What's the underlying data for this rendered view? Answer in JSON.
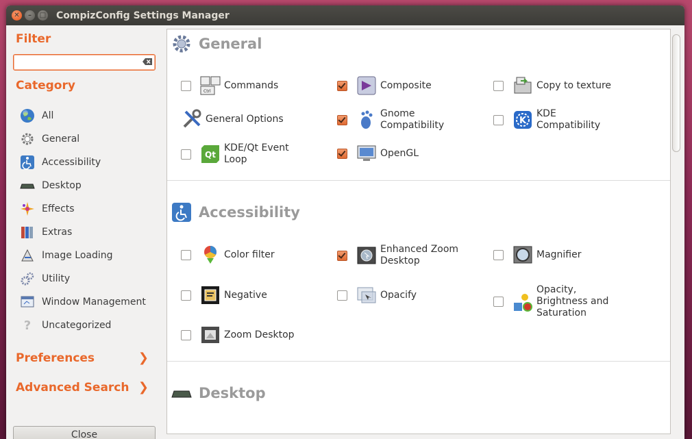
{
  "window": {
    "title": "CompizConfig Settings Manager"
  },
  "sidebar": {
    "filter_heading": "Filter",
    "filter_value": "",
    "category_heading": "Category",
    "categories": [
      {
        "label": "All",
        "icon": "globe-icon"
      },
      {
        "label": "General",
        "icon": "gear-icon"
      },
      {
        "label": "Accessibility",
        "icon": "wheelchair-icon"
      },
      {
        "label": "Desktop",
        "icon": "desktop-icon"
      },
      {
        "label": "Effects",
        "icon": "sparkle-icon"
      },
      {
        "label": "Extras",
        "icon": "books-icon"
      },
      {
        "label": "Image Loading",
        "icon": "image-loading-icon"
      },
      {
        "label": "Utility",
        "icon": "utility-gears-icon"
      },
      {
        "label": "Window Management",
        "icon": "window-icon"
      },
      {
        "label": "Uncategorized",
        "icon": "question-icon"
      }
    ],
    "preferences": "Preferences",
    "advanced_search": "Advanced Search",
    "close_label": "Close"
  },
  "sections": {
    "general": {
      "title": "General",
      "plugins": [
        {
          "label": "Commands",
          "checked": false
        },
        {
          "label": "Composite",
          "checked": true
        },
        {
          "label": "Copy to texture",
          "checked": false
        },
        {
          "label": "General Options",
          "checked": null
        },
        {
          "label_line1": "Gnome",
          "label_line2": "Compatibility",
          "checked": true
        },
        {
          "label_line1": "KDE",
          "label_line2": "Compatibility",
          "checked": false
        },
        {
          "label_line1": "KDE/Qt Event",
          "label_line2": "Loop",
          "checked": false
        },
        {
          "label": "OpenGL",
          "checked": true
        }
      ]
    },
    "accessibility": {
      "title": "Accessibility",
      "plugins": [
        {
          "label": "Color filter",
          "checked": false
        },
        {
          "label_line1": "Enhanced Zoom",
          "label_line2": "Desktop",
          "checked": true
        },
        {
          "label": "Magnifier",
          "checked": false
        },
        {
          "label": "Negative",
          "checked": false
        },
        {
          "label": "Opacify",
          "checked": false
        },
        {
          "label_line1": "Opacity,",
          "label_line2": "Brightness and",
          "label_line3": "Saturation",
          "checked": false
        },
        {
          "label": "Zoom Desktop",
          "checked": false
        }
      ]
    },
    "desktop": {
      "title": "Desktop"
    }
  },
  "colors": {
    "accent": "#e9682b",
    "heading_grey": "#9a9a9a"
  }
}
